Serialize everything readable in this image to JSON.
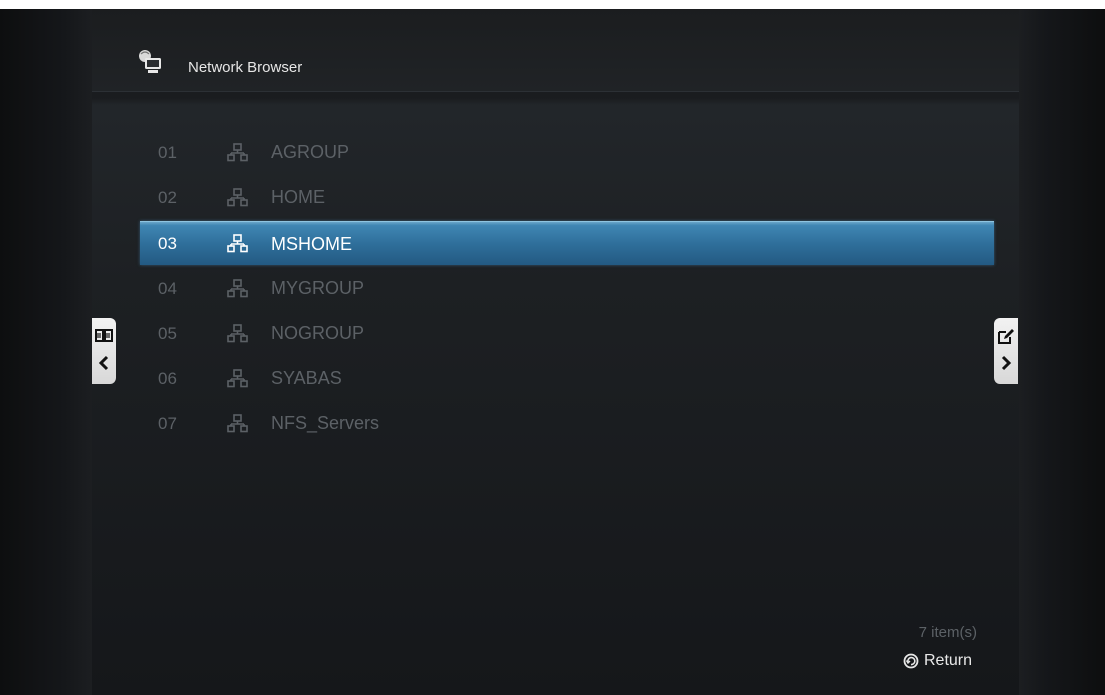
{
  "header": {
    "title": "Network Browser",
    "icon": "network-computer-icon"
  },
  "list": {
    "items": [
      {
        "num": "01",
        "label": "AGROUP",
        "icon": "network-group-icon",
        "selected": false
      },
      {
        "num": "02",
        "label": "HOME",
        "icon": "network-group-icon",
        "selected": false
      },
      {
        "num": "03",
        "label": "MSHOME",
        "icon": "network-group-icon",
        "selected": true
      },
      {
        "num": "04",
        "label": "MYGROUP",
        "icon": "network-group-icon",
        "selected": false
      },
      {
        "num": "05",
        "label": "NOGROUP",
        "icon": "network-group-icon",
        "selected": false
      },
      {
        "num": "06",
        "label": "SYABAS",
        "icon": "network-group-icon",
        "selected": false
      },
      {
        "num": "07",
        "label": "NFS_Servers",
        "icon": "network-group-icon",
        "selected": false
      }
    ]
  },
  "side_tabs": {
    "left": {
      "icon": "book-icon",
      "arrow": "chevron-left-icon"
    },
    "right": {
      "icon": "edit-icon",
      "arrow": "chevron-right-icon"
    }
  },
  "footer": {
    "count": "7 item(s)",
    "return_label": "Return",
    "return_icon": "return-icon"
  },
  "colors": {
    "selection": "#2f6f9b",
    "text_dim": "#5c6166",
    "text_bright": "#ffffff"
  }
}
